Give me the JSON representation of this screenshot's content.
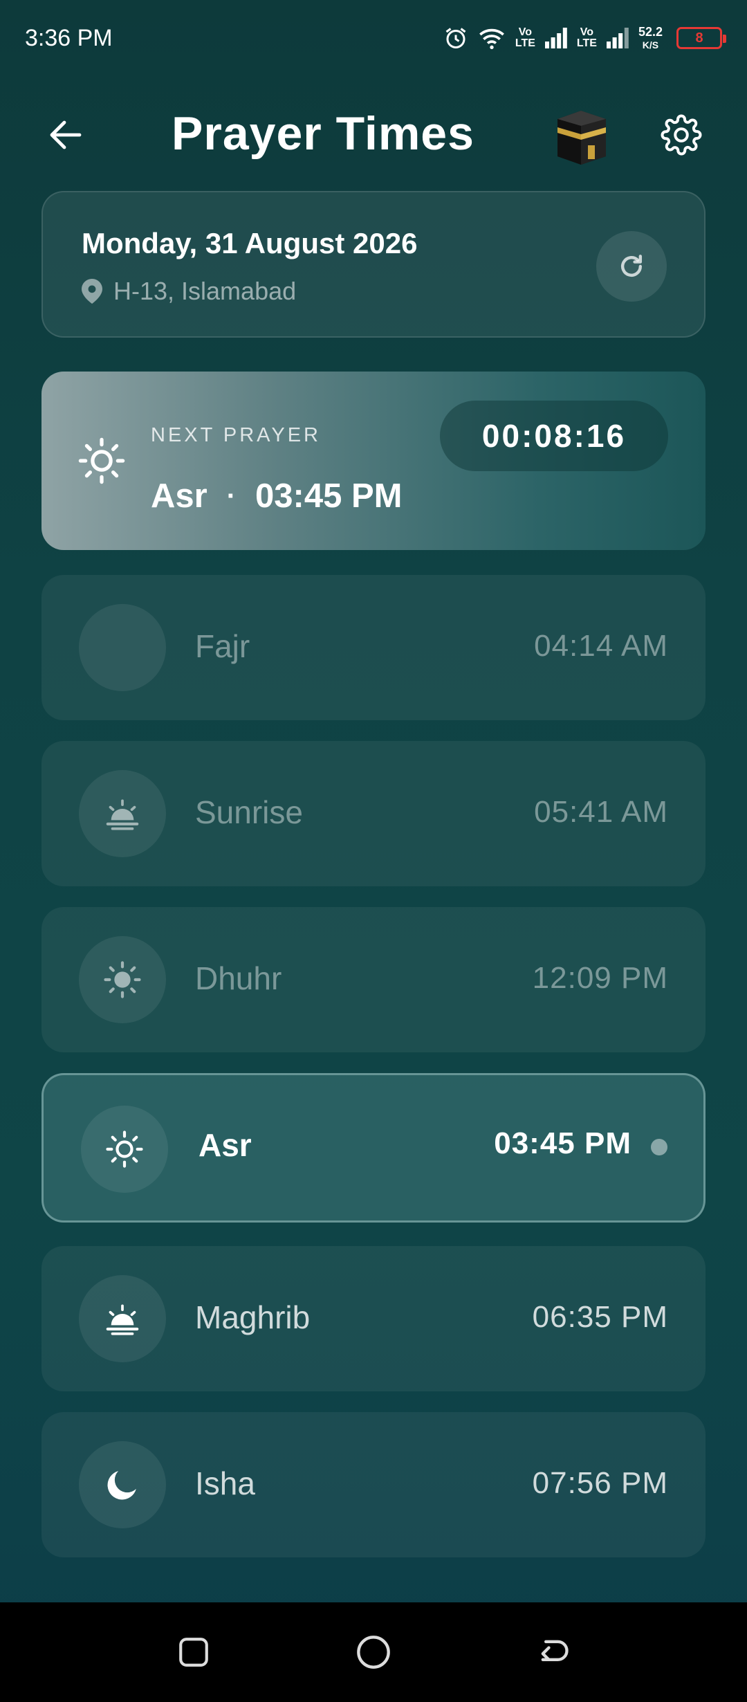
{
  "status_bar": {
    "time": "3:36 PM",
    "lte1": "Vo\nLTE",
    "lte2": "Vo\nLTE",
    "speed_value": "52.2",
    "speed_unit": "K/S",
    "battery": "8",
    "battery_color": "#e53935"
  },
  "header": {
    "title": "Prayer Times",
    "back_icon": "arrow-left-icon",
    "qibla_icon": "kaaba-icon",
    "settings_icon": "gear-icon"
  },
  "date_card": {
    "date": "Monday, 31 August 2026",
    "location": "H-13, Islamabad",
    "refresh_icon": "refresh-icon"
  },
  "next_prayer": {
    "label": "NEXT PRAYER",
    "name": "Asr",
    "separator": "·",
    "time": "03:45 PM",
    "countdown": "00:08:16",
    "icon": "sun-icon"
  },
  "prayers": [
    {
      "name": "Fajr",
      "time": "04:14 AM",
      "icon": "crescent-moon-icon",
      "state": "past"
    },
    {
      "name": "Sunrise",
      "time": "05:41 AM",
      "icon": "sunrise-icon",
      "state": "past"
    },
    {
      "name": "Dhuhr",
      "time": "12:09 PM",
      "icon": "sun-icon",
      "state": "past"
    },
    {
      "name": "Asr",
      "time": "03:45 PM",
      "icon": "sun-outline-icon",
      "state": "current"
    },
    {
      "name": "Maghrib",
      "time": "06:35 PM",
      "icon": "sunset-icon",
      "state": "upcoming"
    },
    {
      "name": "Isha",
      "time": "07:56 PM",
      "icon": "moon-icon",
      "state": "upcoming"
    }
  ],
  "nav": {
    "recents_icon": "square-icon",
    "home_icon": "circle-icon",
    "back_icon": "back-arrow-icon"
  },
  "colors": {
    "background": "#0f4244",
    "accent": "#2c6467",
    "battery_low": "#e53935"
  }
}
